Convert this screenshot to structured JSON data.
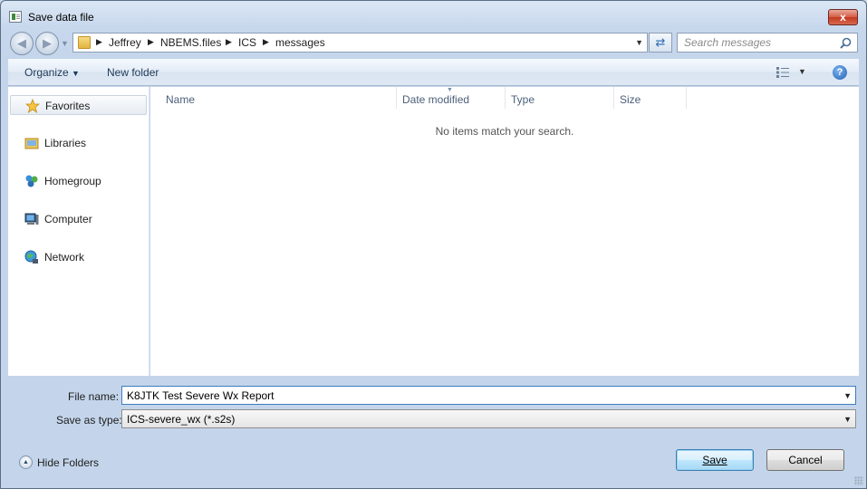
{
  "window": {
    "title": "Save data file",
    "close_label": "x"
  },
  "address": {
    "crumbs": [
      "Jeffrey",
      "NBEMS.files",
      "ICS",
      "messages"
    ]
  },
  "search": {
    "placeholder": "Search messages"
  },
  "toolbar": {
    "organize_label": "Organize",
    "new_folder_label": "New folder",
    "help_label": "?"
  },
  "nav": {
    "items": [
      {
        "label": "Favorites",
        "icon": "star-icon"
      },
      {
        "label": "Libraries",
        "icon": "libraries-icon"
      },
      {
        "label": "Homegroup",
        "icon": "homegroup-icon"
      },
      {
        "label": "Computer",
        "icon": "computer-icon"
      },
      {
        "label": "Network",
        "icon": "network-icon"
      }
    ]
  },
  "list": {
    "columns": [
      "Name",
      "Date modified",
      "Type",
      "Size"
    ],
    "empty_message": "No items match your search."
  },
  "form": {
    "file_name_label": "File name:",
    "file_name_value": "K8JTK Test Severe Wx Report",
    "save_type_label": "Save as type:",
    "save_type_value": "ICS-severe_wx (*.s2s)"
  },
  "footer": {
    "hide_folders_label": "Hide Folders",
    "save_label": "Save",
    "cancel_label": "Cancel"
  },
  "colors": {
    "accent": "#3c7fb1",
    "window_bg": "#c7d7ec"
  }
}
